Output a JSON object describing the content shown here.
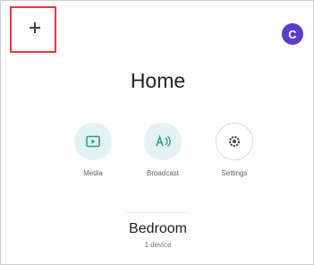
{
  "header": {
    "add_button_glyph": "+",
    "avatar_initial": "C",
    "avatar_color": "#5a3ec8",
    "highlight_color": "#e23b44"
  },
  "home": {
    "title": "Home"
  },
  "actions": [
    {
      "label": "Media",
      "icon": "media-icon"
    },
    {
      "label": "Broadcast",
      "icon": "broadcast-icon"
    },
    {
      "label": "Settings",
      "icon": "settings-icon"
    }
  ],
  "room": {
    "name": "Bedroom",
    "subtitle": "1 device"
  }
}
